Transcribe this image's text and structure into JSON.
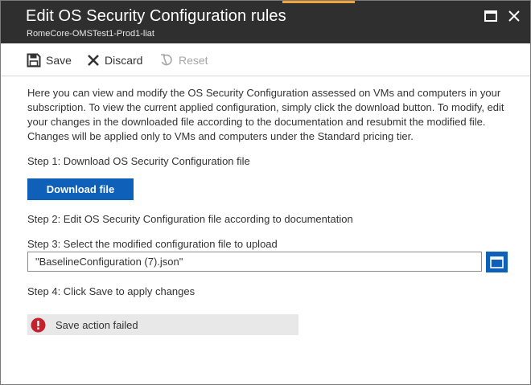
{
  "header": {
    "title": "Edit OS Security Configuration rules",
    "subtitle": "RomeCore-OMSTest1-Prod1-liat"
  },
  "toolbar": {
    "save_label": "Save",
    "discard_label": "Discard",
    "reset_label": "Reset"
  },
  "main": {
    "description": "Here you can view and modify the OS Security Configuration assessed on VMs and computers in your subscription. To view the current applied configuration, simply click the download button. To modify, edit your changes in the downloaded file according to the documentation and resubmit the modified file. Changes will be applied only to VMs and computers under the Standard pricing tier.",
    "step1": "Step 1: Download OS Security Configuration file",
    "download_button": "Download file",
    "step2": "Step 2: Edit OS Security Configuration file according to documentation",
    "step3": "Step 3: Select the modified configuration file to upload",
    "file_value": "\"BaselineConfiguration (7).json\"",
    "step4": "Step 4: Click Save to apply changes"
  },
  "status": {
    "error_message": "Save action failed"
  },
  "colors": {
    "header_bg": "#2f2f2f",
    "accent": "#f2a33a",
    "primary_button": "#0f60b8",
    "error": "#c5212d"
  },
  "icons": {
    "maximize": "maximize-icon",
    "close": "close-icon",
    "save": "save-icon",
    "discard": "discard-icon",
    "reset": "reset-icon",
    "browse": "folder-icon",
    "error": "error-icon"
  }
}
